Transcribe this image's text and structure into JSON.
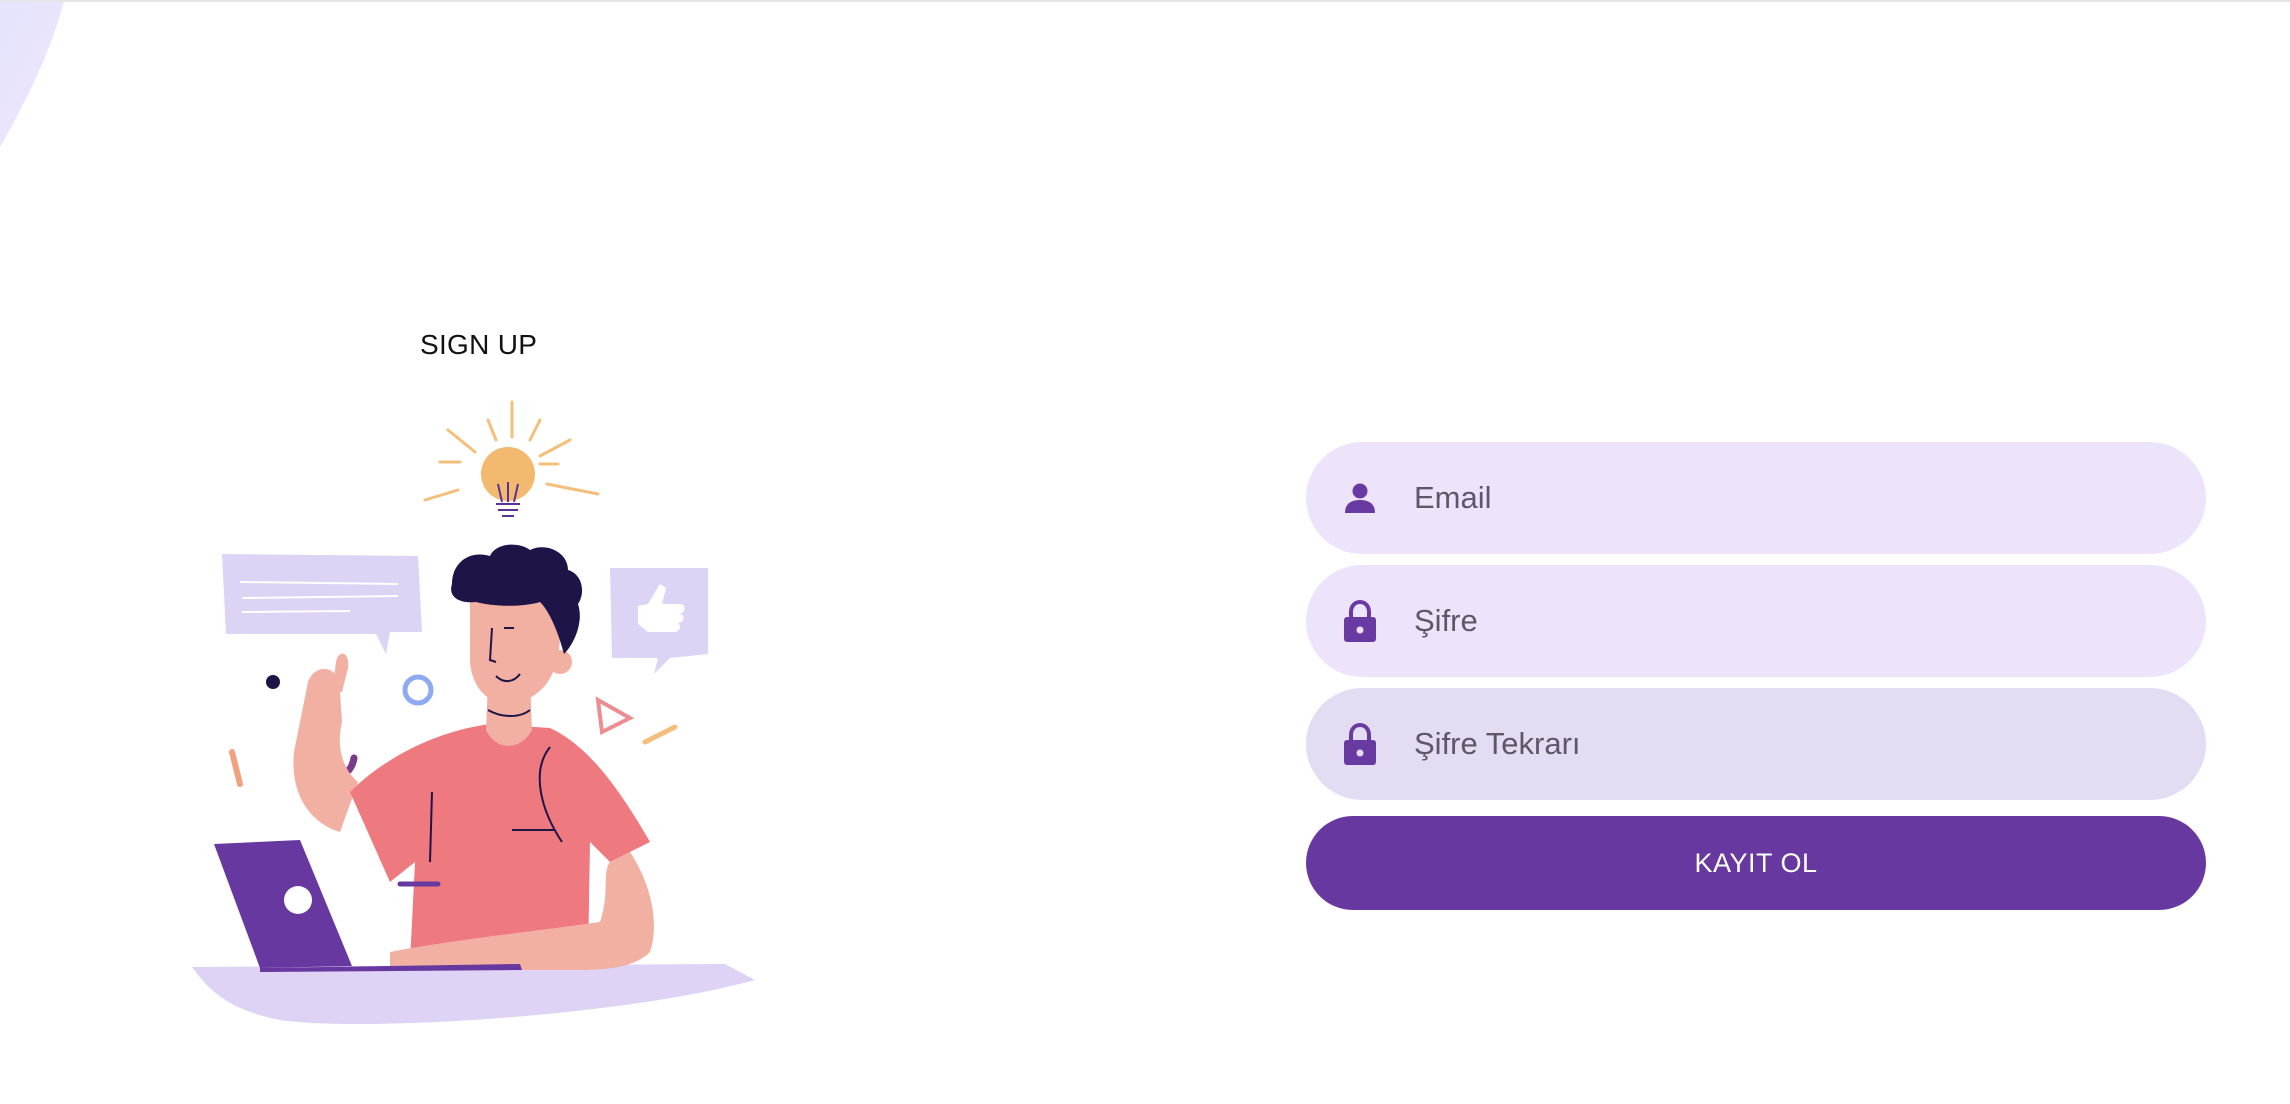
{
  "page": {
    "title": "SIGN UP"
  },
  "form": {
    "email": {
      "placeholder": "Email",
      "value": "",
      "icon": "person-icon"
    },
    "password": {
      "placeholder": "Şifre",
      "value": "",
      "icon": "lock-icon"
    },
    "password_repeat": {
      "placeholder": "Şifre Tekrarı",
      "value": "",
      "icon": "lock-icon"
    },
    "submit_label": "KAYIT OL"
  },
  "colors": {
    "accent": "#67389f",
    "field_bg": "#ede4fb",
    "field_bg_active": "#e4dcf3",
    "icon": "#6a3aa3"
  }
}
